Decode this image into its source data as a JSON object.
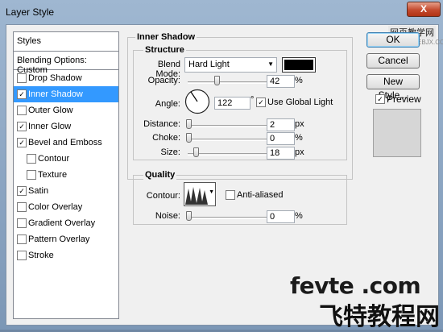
{
  "window": {
    "title": "Layer Style",
    "close_symbol": "X",
    "watermark_cn": "网页教学网",
    "watermark_url": "WWW.WEBJX.COM"
  },
  "styles_panel": {
    "header": "Styles",
    "blending_options": "Blending Options: Custom",
    "items": [
      {
        "label": "Drop Shadow",
        "checked": false,
        "selected": false,
        "indent": false
      },
      {
        "label": "Inner Shadow",
        "checked": true,
        "selected": true,
        "indent": false
      },
      {
        "label": "Outer Glow",
        "checked": false,
        "selected": false,
        "indent": false
      },
      {
        "label": "Inner Glow",
        "checked": true,
        "selected": false,
        "indent": false
      },
      {
        "label": "Bevel and Emboss",
        "checked": true,
        "selected": false,
        "indent": false
      },
      {
        "label": "Contour",
        "checked": false,
        "selected": false,
        "indent": true
      },
      {
        "label": "Texture",
        "checked": false,
        "selected": false,
        "indent": true
      },
      {
        "label": "Satin",
        "checked": true,
        "selected": false,
        "indent": false
      },
      {
        "label": "Color Overlay",
        "checked": false,
        "selected": false,
        "indent": false
      },
      {
        "label": "Gradient Overlay",
        "checked": false,
        "selected": false,
        "indent": false
      },
      {
        "label": "Pattern Overlay",
        "checked": false,
        "selected": false,
        "indent": false
      },
      {
        "label": "Stroke",
        "checked": false,
        "selected": false,
        "indent": false
      }
    ]
  },
  "inner_shadow": {
    "title": "Inner Shadow",
    "structure": {
      "legend": "Structure",
      "blend_mode_label": "Blend Mode:",
      "blend_mode_value": "Hard Light",
      "shadow_color": "#000000",
      "opacity_label": "Opacity:",
      "opacity_value": "42",
      "opacity_unit": "%",
      "angle_label": "Angle:",
      "angle_value": "122",
      "angle_unit": "°",
      "use_global_light_label": "Use Global Light",
      "use_global_light_checked": true,
      "distance_label": "Distance:",
      "distance_value": "2",
      "distance_unit": "px",
      "choke_label": "Choke:",
      "choke_value": "0",
      "choke_unit": "%",
      "size_label": "Size:",
      "size_value": "18",
      "size_unit": "px"
    },
    "quality": {
      "legend": "Quality",
      "contour_label": "Contour:",
      "anti_aliased_label": "Anti-aliased",
      "anti_aliased_checked": false,
      "noise_label": "Noise:",
      "noise_value": "0",
      "noise_unit": "%"
    }
  },
  "buttons": {
    "ok": "OK",
    "cancel": "Cancel",
    "new_style": "New Style...",
    "preview_label": "Preview",
    "preview_checked": true
  },
  "branding": {
    "logo_text": "fevte .com",
    "logo_cn": "飞特教程网"
  }
}
